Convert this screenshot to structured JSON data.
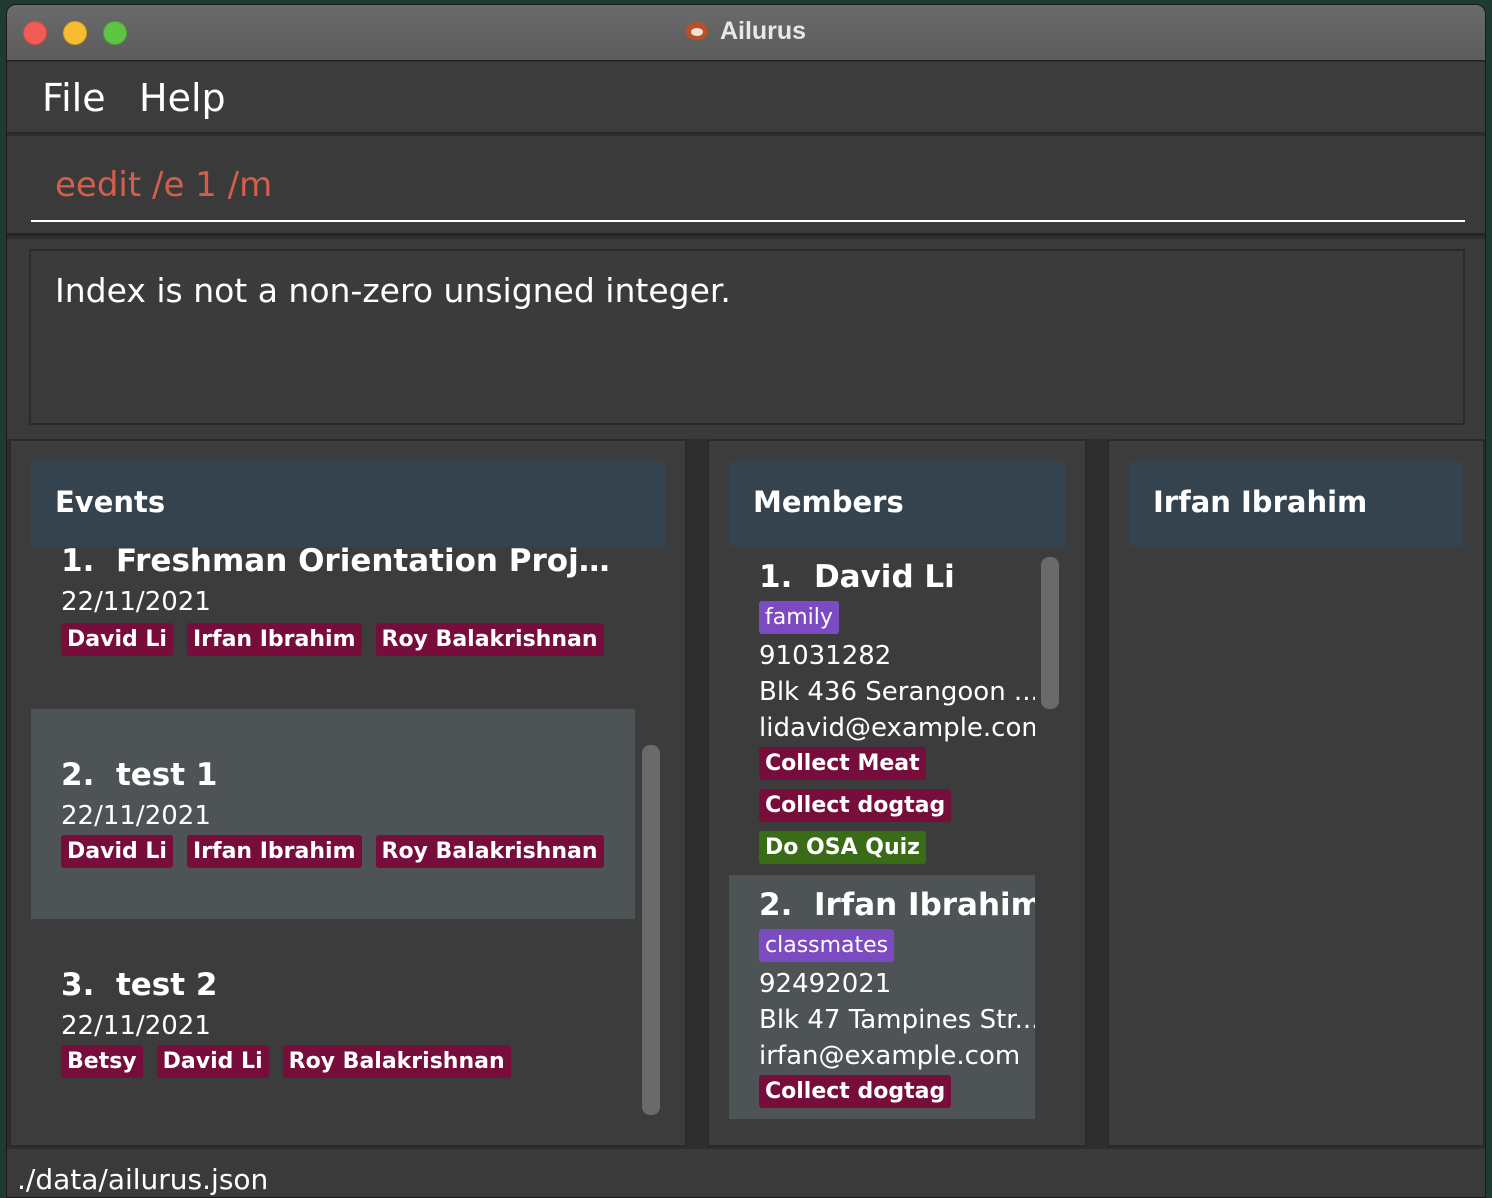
{
  "window": {
    "title": "Ailurus",
    "app_icon": "red-panda-icon"
  },
  "menu": {
    "file": "File",
    "help": "Help"
  },
  "command": {
    "value": "eedit /e 1 /m"
  },
  "result": {
    "message": "Index is not a non-zero unsigned integer."
  },
  "events": {
    "header": "Events",
    "items": [
      {
        "index": "1.",
        "name": "Freshman Orientation Project ...",
        "date": "22/11/2021",
        "members": [
          "David Li",
          "Irfan Ibrahim",
          "Roy Balakrishnan"
        ]
      },
      {
        "index": "2.",
        "name": "test 1",
        "date": "22/11/2021",
        "members": [
          "David Li",
          "Irfan Ibrahim",
          "Roy Balakrishnan"
        ]
      },
      {
        "index": "3.",
        "name": "test 2",
        "date": "22/11/2021",
        "members": [
          "Betsy",
          "David Li",
          "Roy Balakrishnan"
        ]
      }
    ]
  },
  "members": {
    "header": "Members",
    "items": [
      {
        "index": "1.",
        "name": "David Li",
        "tag": "family",
        "phone": "91031282",
        "address": "Blk 436 Serangoon ...",
        "email": "lidavid@example.com",
        "tasks": [
          {
            "label": "Collect Meat",
            "status": "incomplete"
          },
          {
            "label": "Collect dogtag",
            "status": "incomplete"
          },
          {
            "label": "Do OSA Quiz",
            "status": "complete"
          }
        ]
      },
      {
        "index": "2.",
        "name": "Irfan Ibrahim",
        "tag": "classmates",
        "phone": "92492021",
        "address": "Blk 47 Tampines Str...",
        "email": "irfan@example.com",
        "tasks": [
          {
            "label": "Collect dogtag",
            "status": "incomplete"
          }
        ]
      }
    ]
  },
  "detail": {
    "header": "Irfan Ibrahim"
  },
  "status": {
    "path": "./data/ailurus.json"
  },
  "colors": {
    "incomplete_task": "#760d3a",
    "complete_task": "#3a6b16",
    "member_tag": "#7c4bc1",
    "command_text": "#d35f4a",
    "panel_header": "#35434f"
  }
}
